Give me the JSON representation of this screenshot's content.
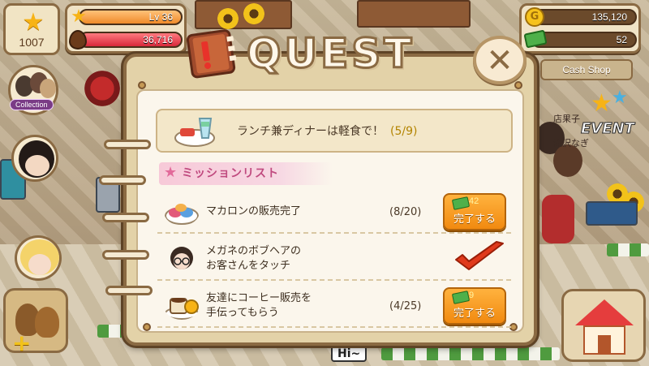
{
  "hud": {
    "level_number": "1007",
    "level_label": "Lv 36",
    "xp_value": "36,716",
    "gold": "135,120",
    "cash": "52",
    "cash_shop_label": "Cash Shop"
  },
  "side": {
    "collection_label": "Collection"
  },
  "event": {
    "label": "EVENT"
  },
  "scene": {
    "shop_sign": "店果子",
    "shop_sign_2": "滝沢なぎ",
    "floor_sign": "Hi~"
  },
  "dialog": {
    "title": "QUEST",
    "close_glyph": "✕",
    "featured": {
      "text": "ランチ兼ディナーは軽食で！",
      "progress": "(5/9)"
    },
    "mission_header": "ミッションリスト",
    "missions": [
      {
        "text_lines": [
          "マカロンの販売完了"
        ],
        "progress": "(8/20)",
        "status": "button",
        "reward": "42",
        "button_label": "完了する",
        "icon": "macaron-icon"
      },
      {
        "text_lines": [
          "メガネのボブヘアの",
          "お客さんをタッチ"
        ],
        "progress": "",
        "status": "done",
        "icon": "customer-avatar-icon"
      },
      {
        "text_lines": [
          "友達にコーヒー販売を",
          "手伝ってもらう"
        ],
        "progress": "(4/25)",
        "status": "button",
        "reward": "9",
        "button_label": "完了する",
        "icon": "coffee-icon"
      }
    ]
  },
  "colors": {
    "accent_orange": "#f18a10",
    "xp_bar": "#f2a64a",
    "coin_bar": "#e8454f",
    "mission_pink": "#c04a7f",
    "check_red": "#e03a1c"
  }
}
